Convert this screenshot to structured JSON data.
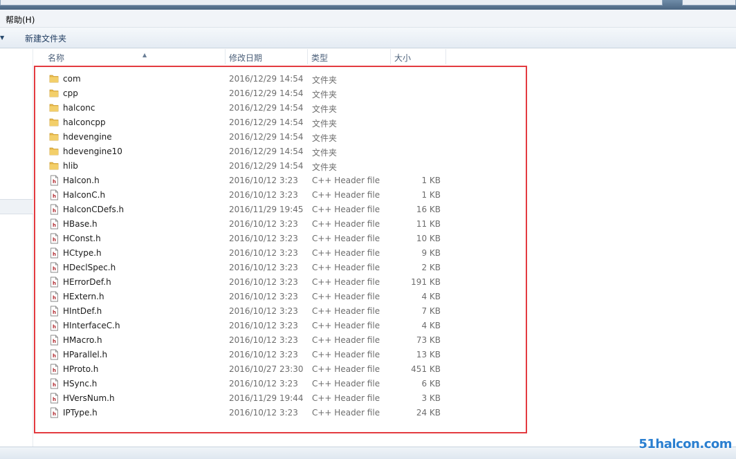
{
  "menubar": {
    "help": "帮助(H)"
  },
  "toolbar": {
    "new_folder": "新建文件夹"
  },
  "columns": {
    "name": "名称",
    "date": "修改日期",
    "type": "类型",
    "size": "大小"
  },
  "files": [
    {
      "name": "com",
      "date": "2016/12/29 14:54",
      "type": "文件夹",
      "size": "",
      "kind": "folder-icon"
    },
    {
      "name": "cpp",
      "date": "2016/12/29 14:54",
      "type": "文件夹",
      "size": "",
      "kind": "folder-icon"
    },
    {
      "name": "halconc",
      "date": "2016/12/29 14:54",
      "type": "文件夹",
      "size": "",
      "kind": "folder-icon"
    },
    {
      "name": "halconcpp",
      "date": "2016/12/29 14:54",
      "type": "文件夹",
      "size": "",
      "kind": "folder-icon"
    },
    {
      "name": "hdevengine",
      "date": "2016/12/29 14:54",
      "type": "文件夹",
      "size": "",
      "kind": "folder-icon"
    },
    {
      "name": "hdevengine10",
      "date": "2016/12/29 14:54",
      "type": "文件夹",
      "size": "",
      "kind": "folder-icon"
    },
    {
      "name": "hlib",
      "date": "2016/12/29 14:54",
      "type": "文件夹",
      "size": "",
      "kind": "folder-icon"
    },
    {
      "name": "Halcon.h",
      "date": "2016/10/12 3:23",
      "type": "C++ Header file",
      "size": "1 KB",
      "kind": "header-file-icon"
    },
    {
      "name": "HalconC.h",
      "date": "2016/10/12 3:23",
      "type": "C++ Header file",
      "size": "1 KB",
      "kind": "header-file-icon"
    },
    {
      "name": "HalconCDefs.h",
      "date": "2016/11/29 19:45",
      "type": "C++ Header file",
      "size": "16 KB",
      "kind": "header-file-icon"
    },
    {
      "name": "HBase.h",
      "date": "2016/10/12 3:23",
      "type": "C++ Header file",
      "size": "11 KB",
      "kind": "header-file-icon"
    },
    {
      "name": "HConst.h",
      "date": "2016/10/12 3:23",
      "type": "C++ Header file",
      "size": "10 KB",
      "kind": "header-file-icon"
    },
    {
      "name": "HCtype.h",
      "date": "2016/10/12 3:23",
      "type": "C++ Header file",
      "size": "9 KB",
      "kind": "header-file-icon"
    },
    {
      "name": "HDeclSpec.h",
      "date": "2016/10/12 3:23",
      "type": "C++ Header file",
      "size": "2 KB",
      "kind": "header-file-icon"
    },
    {
      "name": "HErrorDef.h",
      "date": "2016/10/12 3:23",
      "type": "C++ Header file",
      "size": "191 KB",
      "kind": "header-file-icon"
    },
    {
      "name": "HExtern.h",
      "date": "2016/10/12 3:23",
      "type": "C++ Header file",
      "size": "4 KB",
      "kind": "header-file-icon"
    },
    {
      "name": "HIntDef.h",
      "date": "2016/10/12 3:23",
      "type": "C++ Header file",
      "size": "7 KB",
      "kind": "header-file-icon"
    },
    {
      "name": "HInterfaceC.h",
      "date": "2016/10/12 3:23",
      "type": "C++ Header file",
      "size": "4 KB",
      "kind": "header-file-icon"
    },
    {
      "name": "HMacro.h",
      "date": "2016/10/12 3:23",
      "type": "C++ Header file",
      "size": "73 KB",
      "kind": "header-file-icon"
    },
    {
      "name": "HParallel.h",
      "date": "2016/10/12 3:23",
      "type": "C++ Header file",
      "size": "13 KB",
      "kind": "header-file-icon"
    },
    {
      "name": "HProto.h",
      "date": "2016/10/27 23:30",
      "type": "C++ Header file",
      "size": "451 KB",
      "kind": "header-file-icon"
    },
    {
      "name": "HSync.h",
      "date": "2016/10/12 3:23",
      "type": "C++ Header file",
      "size": "6 KB",
      "kind": "header-file-icon"
    },
    {
      "name": "HVersNum.h",
      "date": "2016/11/29 19:44",
      "type": "C++ Header file",
      "size": "3 KB",
      "kind": "header-file-icon"
    },
    {
      "name": "IPType.h",
      "date": "2016/10/12 3:23",
      "type": "C++ Header file",
      "size": "24 KB",
      "kind": "header-file-icon"
    }
  ],
  "watermark": "51halcon.com",
  "colors": {
    "highlight_box": "#e33a3f",
    "folder": "#e8b84a",
    "header_glyph": "#b0282e"
  }
}
